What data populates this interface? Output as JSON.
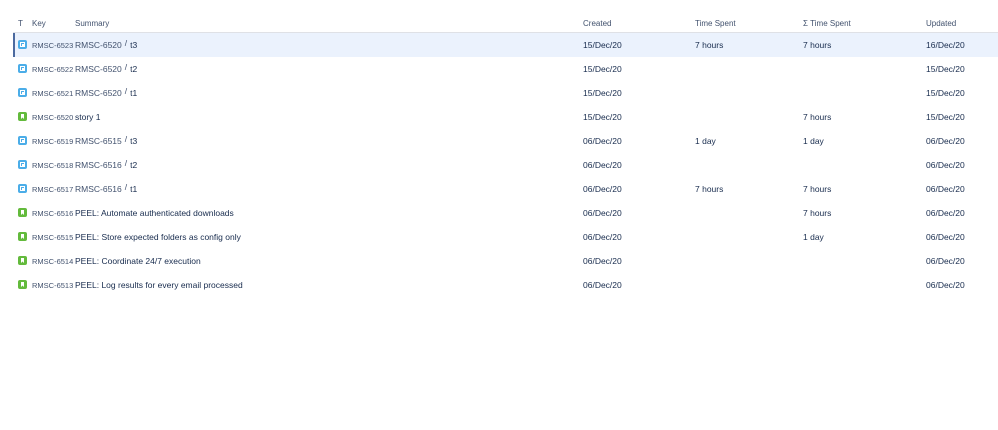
{
  "headers": {
    "type": "T",
    "key": "Key",
    "summary": "Summary",
    "created": "Created",
    "time_spent": "Time Spent",
    "sigma_time_spent": "Σ Time Spent",
    "updated": "Updated"
  },
  "rows": [
    {
      "type": "subtask",
      "key": "RMSC-6523",
      "parent": "RMSC-6520",
      "summary": "t3",
      "created": "15/Dec/20",
      "time_spent": "7 hours",
      "sigma_time_spent": "7 hours",
      "updated": "16/Dec/20"
    },
    {
      "type": "subtask",
      "key": "RMSC-6522",
      "parent": "RMSC-6520",
      "summary": "t2",
      "created": "15/Dec/20",
      "time_spent": "",
      "sigma_time_spent": "",
      "updated": "15/Dec/20"
    },
    {
      "type": "subtask",
      "key": "RMSC-6521",
      "parent": "RMSC-6520",
      "summary": "t1",
      "created": "15/Dec/20",
      "time_spent": "",
      "sigma_time_spent": "",
      "updated": "15/Dec/20"
    },
    {
      "type": "story",
      "key": "RMSC-6520",
      "parent": "",
      "summary": "story 1",
      "created": "15/Dec/20",
      "time_spent": "",
      "sigma_time_spent": "7 hours",
      "updated": "15/Dec/20"
    },
    {
      "type": "subtask",
      "key": "RMSC-6519",
      "parent": "RMSC-6515",
      "summary": "t3",
      "created": "06/Dec/20",
      "time_spent": "1 day",
      "sigma_time_spent": "1 day",
      "updated": "06/Dec/20"
    },
    {
      "type": "subtask",
      "key": "RMSC-6518",
      "parent": "RMSC-6516",
      "summary": "t2",
      "created": "06/Dec/20",
      "time_spent": "",
      "sigma_time_spent": "",
      "updated": "06/Dec/20"
    },
    {
      "type": "subtask",
      "key": "RMSC-6517",
      "parent": "RMSC-6516",
      "summary": "t1",
      "created": "06/Dec/20",
      "time_spent": "7 hours",
      "sigma_time_spent": "7 hours",
      "updated": "06/Dec/20"
    },
    {
      "type": "story",
      "key": "RMSC-6516",
      "parent": "",
      "summary": "PEEL: Automate authenticated downloads",
      "created": "06/Dec/20",
      "time_spent": "",
      "sigma_time_spent": "7 hours",
      "updated": "06/Dec/20"
    },
    {
      "type": "story",
      "key": "RMSC-6515",
      "parent": "",
      "summary": "PEEL: Store expected folders as config only",
      "created": "06/Dec/20",
      "time_spent": "",
      "sigma_time_spent": "1 day",
      "updated": "06/Dec/20"
    },
    {
      "type": "story",
      "key": "RMSC-6514",
      "parent": "",
      "summary": "PEEL: Coordinate 24/7 execution",
      "created": "06/Dec/20",
      "time_spent": "",
      "sigma_time_spent": "",
      "updated": "06/Dec/20"
    },
    {
      "type": "story",
      "key": "RMSC-6513",
      "parent": "",
      "summary": "PEEL: Log results for every email processed",
      "created": "06/Dec/20",
      "time_spent": "",
      "sigma_time_spent": "",
      "updated": "06/Dec/20"
    }
  ],
  "separator": "/",
  "selected_row": 0,
  "colors": {
    "subtask_icon": "#4bade8",
    "story_icon": "#63ba3c",
    "selected_row_bg": "#ebf2fd"
  }
}
